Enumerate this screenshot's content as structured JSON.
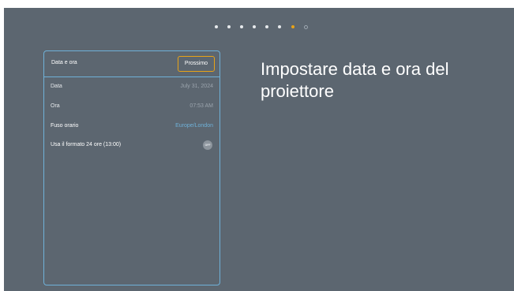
{
  "pager": {
    "total": 8,
    "active_index": 6
  },
  "panel": {
    "title": "Data e ora",
    "next_label": "Prossimo",
    "rows": {
      "date": {
        "label": "Data",
        "value": "July 31, 2024"
      },
      "time": {
        "label": "Ora",
        "value": "07:53 AM"
      },
      "timezone": {
        "label": "Fuso orario",
        "value": "Europe/London"
      },
      "format24": {
        "label": "Usa il formato 24 ore (13:00)",
        "toggle_state": "OFF"
      }
    }
  },
  "heading": "Impostare data e ora del proiettore",
  "colors": {
    "background": "#5c6670",
    "accent_border": "#6fb1d8",
    "active_dot": "#e8a317",
    "link": "#6fb1d8"
  }
}
